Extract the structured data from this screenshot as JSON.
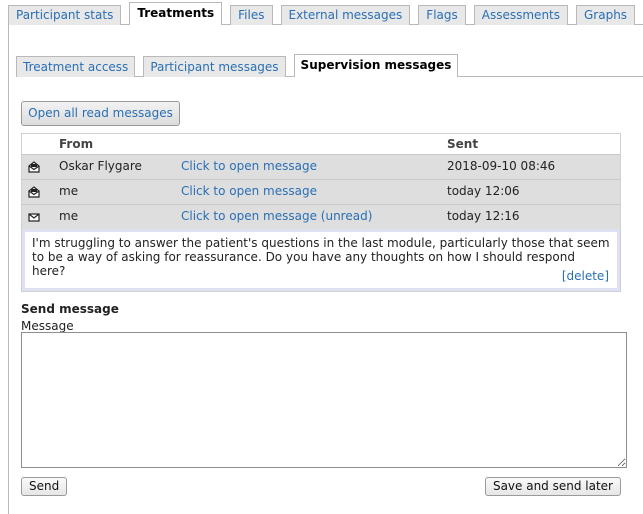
{
  "top_tabs": [
    {
      "label": "Participant stats",
      "active": false
    },
    {
      "label": "Treatments",
      "active": true
    },
    {
      "label": "Files",
      "active": false
    },
    {
      "label": "External messages",
      "active": false
    },
    {
      "label": "Flags",
      "active": false
    },
    {
      "label": "Assessments",
      "active": false
    },
    {
      "label": "Graphs",
      "active": false
    }
  ],
  "sub_tabs": [
    {
      "label": "Treatment access",
      "active": false
    },
    {
      "label": "Participant messages",
      "active": false
    },
    {
      "label": "Supervision messages",
      "active": true
    }
  ],
  "open_all_label": "Open all read messages",
  "table": {
    "headers": {
      "from": "From",
      "sent": "Sent"
    },
    "rows": [
      {
        "icon": "envelope-open-icon",
        "from": "Oskar Flygare",
        "link": "Click to open message",
        "sent": "2018-09-10 08:46"
      },
      {
        "icon": "envelope-open-icon",
        "from": "me",
        "link": "Click to open message",
        "sent": "today 12:06"
      },
      {
        "icon": "envelope-closed-icon",
        "from": "me",
        "link": "Click to open message (unread)",
        "sent": "today 12:16"
      }
    ],
    "open_message": {
      "body": "I'm struggling to answer the patient's questions in the last module, particularly those that seem to be a way of asking for reassurance. Do you have any thoughts on how I should respond here?",
      "delete_label": "[delete]"
    }
  },
  "send": {
    "title": "Send message",
    "message_label": "Message",
    "message_value": "",
    "send_label": "Send",
    "save_later_label": "Save and send later"
  },
  "colors": {
    "link": "#2a6fb4",
    "row_bg": "#dedede",
    "tab_bg": "#e8e8e8"
  }
}
